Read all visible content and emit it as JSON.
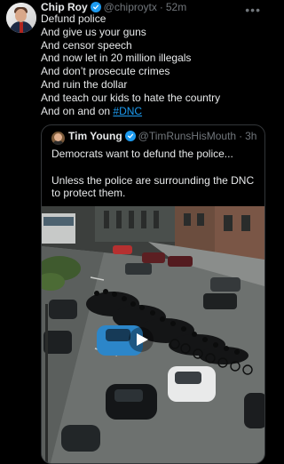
{
  "post": {
    "author_name": "Chip Roy",
    "handle": "@chiproytx",
    "separator": "·",
    "time": "52m",
    "lines": [
      "Defund police",
      "And give us your guns",
      "And censor speech",
      "And now let in 20 million illegals",
      "And don’t prosecute crimes",
      "And ruin the dollar",
      "And teach our kids to hate the country"
    ],
    "last_line_prefix": "And on and on ",
    "hashtag": "#DNC",
    "more_icon": "more-horizontal-icon"
  },
  "quoted": {
    "author_name": "Tim Young",
    "handle": "@TimRunsHisMouth",
    "separator": "·",
    "time": "3h",
    "lines": [
      "Democrats want to defund the police...",
      "",
      "Unless the police are surrounding the DNC",
      "to protect them."
    ]
  },
  "colors": {
    "background": "#000000",
    "text": "#e7e9ea",
    "muted": "#71767b",
    "link": "#1d9bf0",
    "verified": "#1d9bf0",
    "border": "#333639"
  }
}
